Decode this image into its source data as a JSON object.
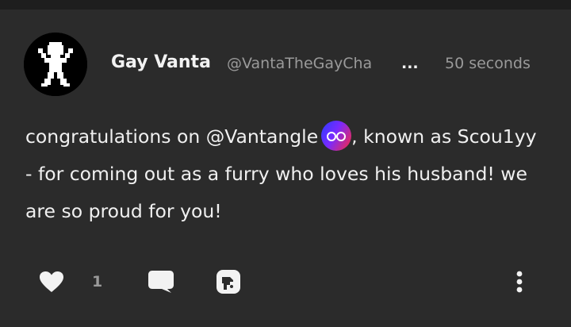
{
  "post": {
    "author": {
      "display_name": "Gay Vanta",
      "handle": "@VantaTheGayCha",
      "handle_ellipsis": "...",
      "avatar_icon": "pixel-figure-avatar"
    },
    "timestamp": "50 seconds",
    "body": {
      "text_before_mention": "congratulations on ",
      "mention": "@Vantangle",
      "mention_avatar_icon": "glasses-avatar",
      "text_after_mention": ", known as Scou1yy - for coming out as a furry who loves his husband! we are so proud for you!"
    },
    "actions": {
      "like_icon": "heart-icon",
      "like_count": "1",
      "comment_icon": "speech-bubble-icon",
      "share_icon": "share-icon",
      "more_icon": "vertical-dots-icon"
    }
  },
  "colors": {
    "background": "#2b2b2b",
    "text_primary": "#f0f0f0",
    "text_secondary": "#9a9a9a"
  }
}
